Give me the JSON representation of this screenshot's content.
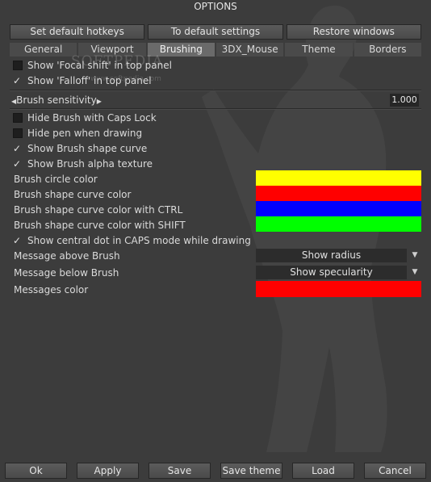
{
  "window": {
    "title": "OPTIONS"
  },
  "hotkey_buttons": [
    "Set default hotkeys",
    "To default settings",
    "Restore windows"
  ],
  "tabs": [
    {
      "label": "General",
      "active": false
    },
    {
      "label": "Viewport",
      "active": false
    },
    {
      "label": "Brushing",
      "active": true
    },
    {
      "label": "3DX_Mouse",
      "active": false
    },
    {
      "label": "Theme",
      "active": false
    },
    {
      "label": "Borders",
      "active": false
    }
  ],
  "watermark": {
    "main": "SOFTPEDIA",
    "sub": "www.softpedia.com"
  },
  "top_options": [
    {
      "label": "Show 'Focal shift' in top panel",
      "checked": false
    },
    {
      "label": "Show 'Falloff' in top panel",
      "checked": true
    }
  ],
  "sensitivity": {
    "label": "Brush sensitivity",
    "value": "1.000"
  },
  "brush_options": [
    {
      "label": "Hide Brush with Caps Lock",
      "checked": false
    },
    {
      "label": "Hide pen when drawing",
      "checked": false
    },
    {
      "label": "Show Brush shape curve",
      "checked": true
    },
    {
      "label": "Show Brush alpha texture",
      "checked": true
    }
  ],
  "colors": [
    {
      "label": "Brush circle color",
      "color": "#ffff00"
    },
    {
      "label": "Brush shape curve color",
      "color": "#ff0000"
    },
    {
      "label": "Brush shape curve color with CTRL",
      "color": "#0000ff"
    },
    {
      "label": "Brush shape curve color with SHIFT",
      "color": "#00ff00"
    }
  ],
  "central_dot": {
    "label": "Show central dot in CAPS mode while drawing",
    "checked": true
  },
  "messages": [
    {
      "label": "Message above Brush",
      "value": "Show radius"
    },
    {
      "label": "Message below Brush",
      "value": "Show specularity"
    }
  ],
  "messages_color": {
    "label": "Messages color",
    "color": "#ff0000"
  },
  "bottom_buttons": [
    "Ok",
    "Apply",
    "Save",
    "Save theme",
    "Load",
    "Cancel"
  ]
}
